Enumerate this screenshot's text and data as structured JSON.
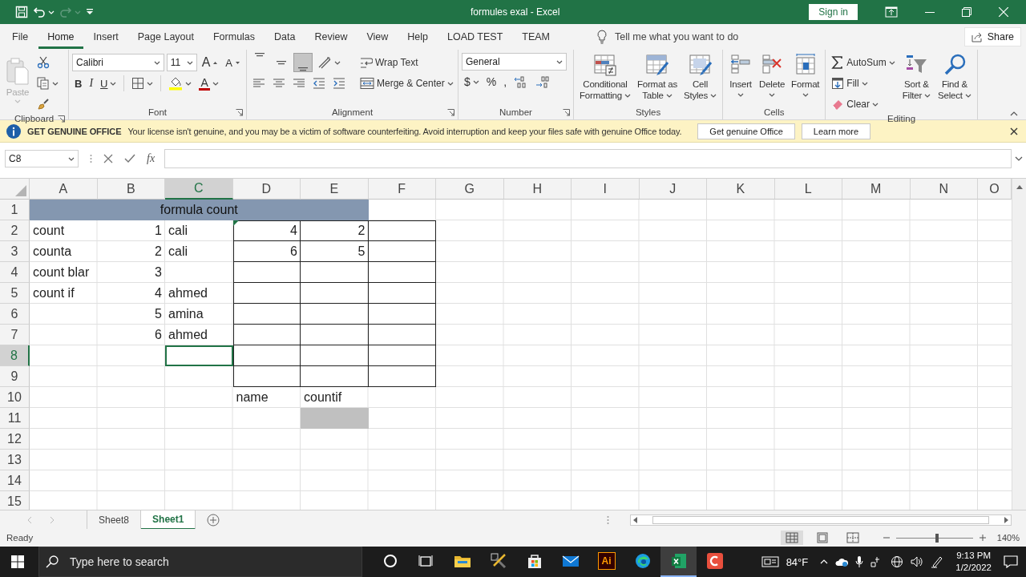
{
  "title_bar": {
    "redo_disabled": true,
    "title": "formules exal  -  Excel",
    "sign_in": "Sign in"
  },
  "menu_tabs": [
    {
      "label": "File",
      "selected": false
    },
    {
      "label": "Home",
      "selected": true
    },
    {
      "label": "Insert",
      "selected": false
    },
    {
      "label": "Page Layout",
      "selected": false
    },
    {
      "label": "Formulas",
      "selected": false
    },
    {
      "label": "Data",
      "selected": false
    },
    {
      "label": "Review",
      "selected": false
    },
    {
      "label": "View",
      "selected": false
    },
    {
      "label": "Help",
      "selected": false
    },
    {
      "label": "LOAD TEST",
      "selected": false
    },
    {
      "label": "TEAM",
      "selected": false
    }
  ],
  "tell_me": {
    "placeholder": "Tell me what you want to do"
  },
  "share": "Share",
  "ribbon": {
    "clipboard": {
      "label": "Clipboard",
      "paste": {
        "label": "Paste",
        "disabled": true
      }
    },
    "font": {
      "label": "Font",
      "font_name": "Calibri",
      "font_size": "11",
      "grow": "A",
      "shrink": "A",
      "bold": "B",
      "italic": "I",
      "underline": "U",
      "font_color": "A"
    },
    "alignment": {
      "label": "Alignment",
      "vertical": [
        {
          "selected": false
        },
        {
          "selected": false
        },
        {
          "selected": true
        }
      ],
      "wrap_text": "Wrap Text",
      "merge_center": "Merge & Center"
    },
    "number": {
      "label": "Number",
      "format": "General",
      "currency": "$",
      "percent": "%",
      "comma": ","
    },
    "styles": {
      "label": "Styles",
      "buttons": [
        {
          "lines": [
            "Conditional",
            "Formatting"
          ]
        },
        {
          "lines": [
            "Format as",
            "Table"
          ]
        },
        {
          "lines": [
            "Cell",
            "Styles"
          ]
        }
      ]
    },
    "cells": {
      "label": "Cells",
      "buttons": [
        {
          "lines": [
            "Insert"
          ]
        },
        {
          "lines": [
            "Delete"
          ]
        },
        {
          "lines": [
            "Format"
          ]
        }
      ]
    },
    "editing": {
      "label": "Editing",
      "autosum": "AutoSum",
      "fill": "Fill",
      "clear": "Clear",
      "buttons": [
        {
          "lines": [
            "Sort &",
            "Filter"
          ]
        },
        {
          "lines": [
            "Find &",
            "Select"
          ]
        }
      ]
    }
  },
  "message_bar": {
    "title": "GET GENUINE OFFICE",
    "text": "Your license isn't genuine, and you may be a victim of software counterfeiting. Avoid interruption and keep your files safe with genuine Office today.",
    "buttons": [
      "Get genuine Office",
      "Learn more"
    ]
  },
  "formula_bar": {
    "name_box": "C8",
    "function_label": "fx"
  },
  "sheet": {
    "columns": [
      {
        "label": "A",
        "selected": false
      },
      {
        "label": "B",
        "selected": false
      },
      {
        "label": "C",
        "selected": true
      },
      {
        "label": "D",
        "selected": false
      },
      {
        "label": "E",
        "selected": false
      },
      {
        "label": "F",
        "selected": false
      },
      {
        "label": "G",
        "selected": false
      },
      {
        "label": "H",
        "selected": false
      },
      {
        "label": "I",
        "selected": false
      },
      {
        "label": "J",
        "selected": false
      },
      {
        "label": "K",
        "selected": false
      },
      {
        "label": "L",
        "selected": false
      },
      {
        "label": "M",
        "selected": false
      },
      {
        "label": "N",
        "selected": false
      },
      {
        "label": "O",
        "selected": false
      }
    ],
    "rows": [
      {
        "label": "1",
        "selected": false,
        "cells": {
          "A": {
            "kind": "title",
            "text": "formula count"
          },
          "B": {
            "kind": "merged"
          },
          "C": {
            "kind": "merged"
          },
          "D": {
            "kind": "merged"
          },
          "E": {
            "kind": "merged"
          }
        }
      },
      {
        "label": "2",
        "selected": false,
        "cells": {
          "A": {
            "kind": "text",
            "text": "count",
            "flagged": false,
            "boxed": false
          },
          "B": {
            "kind": "number",
            "text": "1",
            "flagged": false,
            "boxed": false
          },
          "C": {
            "kind": "text",
            "text": "cali",
            "flagged": false,
            "boxed": false
          },
          "D": {
            "kind": "number",
            "text": "4",
            "flagged": true,
            "boxed": true
          },
          "E": {
            "kind": "number",
            "text": "2",
            "flagged": false,
            "boxed": true
          },
          "F": {
            "kind": "empty",
            "flagged": false,
            "boxed": true
          }
        }
      },
      {
        "label": "3",
        "selected": false,
        "cells": {
          "A": {
            "kind": "text",
            "text": "counta",
            "flagged": false,
            "boxed": false
          },
          "B": {
            "kind": "number",
            "text": "2",
            "flagged": false,
            "boxed": false
          },
          "C": {
            "kind": "text",
            "text": "cali",
            "flagged": false,
            "boxed": false
          },
          "D": {
            "kind": "number",
            "text": "6",
            "flagged": false,
            "boxed": true
          },
          "E": {
            "kind": "number",
            "text": "5",
            "flagged": false,
            "boxed": true
          },
          "F": {
            "kind": "empty",
            "flagged": false,
            "boxed": true
          }
        }
      },
      {
        "label": "4",
        "selected": false,
        "cells": {
          "A": {
            "kind": "text",
            "text": "count blar",
            "flagged": false,
            "boxed": false
          },
          "B": {
            "kind": "number",
            "text": "3",
            "flagged": false,
            "boxed": false
          },
          "D": {
            "kind": "empty",
            "flagged": false,
            "boxed": true
          },
          "E": {
            "kind": "empty",
            "flagged": false,
            "boxed": true
          },
          "F": {
            "kind": "empty",
            "flagged": false,
            "boxed": true
          }
        }
      },
      {
        "label": "5",
        "selected": false,
        "cells": {
          "A": {
            "kind": "text",
            "text": "count if",
            "flagged": false,
            "boxed": false
          },
          "B": {
            "kind": "number",
            "text": "4",
            "flagged": false,
            "boxed": false
          },
          "C": {
            "kind": "text",
            "text": "ahmed",
            "flagged": false,
            "boxed": false
          },
          "D": {
            "kind": "empty",
            "flagged": false,
            "boxed": true
          },
          "E": {
            "kind": "empty",
            "flagged": false,
            "boxed": true
          },
          "F": {
            "kind": "empty",
            "flagged": false,
            "boxed": true
          }
        }
      },
      {
        "label": "6",
        "selected": false,
        "cells": {
          "B": {
            "kind": "number",
            "text": "5",
            "flagged": false,
            "boxed": false
          },
          "C": {
            "kind": "text",
            "text": "amina",
            "flagged": false,
            "boxed": false
          },
          "D": {
            "kind": "empty",
            "flagged": false,
            "boxed": true
          },
          "E": {
            "kind": "empty",
            "flagged": false,
            "boxed": true
          },
          "F": {
            "kind": "empty",
            "flagged": false,
            "boxed": true
          }
        }
      },
      {
        "label": "7",
        "selected": false,
        "cells": {
          "B": {
            "kind": "number",
            "text": "6",
            "flagged": false,
            "boxed": false
          },
          "C": {
            "kind": "text",
            "text": "ahmed",
            "flagged": false,
            "boxed": false
          },
          "D": {
            "kind": "empty",
            "flagged": false,
            "boxed": true
          },
          "E": {
            "kind": "empty",
            "flagged": false,
            "boxed": true
          },
          "F": {
            "kind": "empty",
            "flagged": false,
            "boxed": true
          }
        }
      },
      {
        "label": "8",
        "selected": true,
        "cells": {
          "D": {
            "kind": "empty",
            "flagged": false,
            "boxed": true
          },
          "E": {
            "kind": "empty",
            "flagged": false,
            "boxed": true
          },
          "F": {
            "kind": "empty",
            "flagged": false,
            "boxed": true
          }
        }
      },
      {
        "label": "9",
        "selected": false,
        "cells": {
          "D": {
            "kind": "empty",
            "flagged": false,
            "boxed": true
          },
          "E": {
            "kind": "empty",
            "flagged": false,
            "boxed": true
          },
          "F": {
            "kind": "empty",
            "flagged": false,
            "boxed": true
          }
        }
      },
      {
        "label": "10",
        "selected": false,
        "cells": {
          "D": {
            "kind": "text",
            "text": "name",
            "flagged": false,
            "boxed": false
          },
          "E": {
            "kind": "text",
            "text": "countif",
            "flagged": false,
            "boxed": false
          }
        }
      },
      {
        "label": "11",
        "selected": false,
        "cells": {
          "E": {
            "kind": "shaded",
            "flagged": false,
            "boxed": false
          }
        }
      },
      {
        "label": "12",
        "selected": false,
        "cells": {}
      },
      {
        "label": "13",
        "selected": false,
        "cells": {}
      },
      {
        "label": "14",
        "selected": false,
        "cells": {}
      },
      {
        "label": "15",
        "selected": false,
        "cells": {}
      }
    ]
  },
  "sheet_tabs": [
    {
      "label": "Sheet8",
      "selected": false
    },
    {
      "label": "Sheet1",
      "selected": true
    }
  ],
  "status_bar": {
    "text": "Ready",
    "views": [
      {
        "selected": true
      },
      {
        "selected": false
      },
      {
        "selected": false
      }
    ],
    "zoom_slider": {
      "level": 0.53
    },
    "zoom": "140%"
  },
  "taskbar": {
    "search": {
      "placeholder": "Type here to search"
    },
    "apps": [
      {
        "selected": false
      },
      {
        "selected": false
      },
      {
        "selected": false
      },
      {
        "selected": false
      },
      {
        "selected": false
      },
      {
        "selected": false
      },
      {
        "selected": false,
        "label": "Ai"
      },
      {
        "selected": false
      },
      {
        "selected": true
      },
      {
        "selected": false
      }
    ],
    "weather": "84°F",
    "time": "9:13 PM",
    "date": "1/2/2022"
  }
}
